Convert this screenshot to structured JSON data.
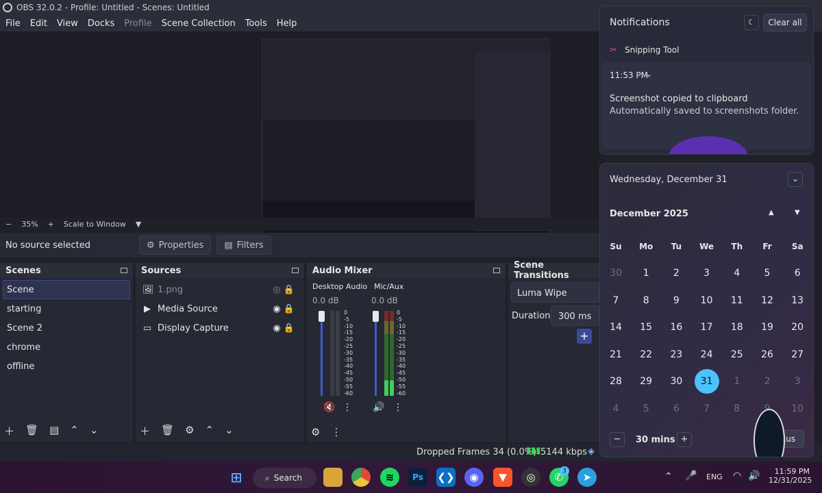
{
  "titlebar": {
    "title": "OBS 32.0.2 - Profile: Untitled - Scenes: Untitled"
  },
  "menu": [
    "File",
    "Edit",
    "View",
    "Docks",
    "Profile",
    "Scene Collection",
    "Tools",
    "Help"
  ],
  "zoom": {
    "minus": "−",
    "value": "35%",
    "plus": "+",
    "mode": "Scale to Window"
  },
  "source_bar": {
    "no_source": "No source selected",
    "properties": "Properties",
    "filters": "Filters"
  },
  "scenes": {
    "title": "Scenes",
    "items": [
      "Scene",
      "starting",
      "Scene 2",
      "chrome",
      "offline"
    ]
  },
  "sources": {
    "title": "Sources",
    "items": [
      {
        "label": "1.png",
        "icon": "image-icon"
      },
      {
        "label": "Media Source",
        "icon": "play-icon"
      },
      {
        "label": "Display Capture",
        "icon": "monitor-icon"
      }
    ]
  },
  "audio": {
    "title": "Audio Mixer",
    "channels": [
      {
        "name": "Desktop Audio",
        "level": "0.0 dB"
      },
      {
        "name": "Mic/Aux",
        "level": "0.0 dB"
      }
    ],
    "scale": [
      "0",
      "-5",
      "-10",
      "-15",
      "-20",
      "-25",
      "-30",
      "-35",
      "-40",
      "-45",
      "-50",
      "-55",
      "-60"
    ]
  },
  "transitions": {
    "title": "Scene Transitions",
    "type": "Luma Wipe",
    "duration_label": "Duration",
    "duration": "300 ms",
    "add": "+"
  },
  "status": {
    "dropped": "Dropped Frames 34 (0.0%)",
    "bitrate": "5144 kbps"
  },
  "notifications": {
    "title": "Notifications",
    "clear": "Clear all",
    "app": "Snipping Tool",
    "time": "11:53 PM",
    "headline": "Screenshot copied to clipboard",
    "body": "Automatically saved to screenshots folder."
  },
  "calendar": {
    "date_header": "Wednesday, December 31",
    "month": "December 2025",
    "dow": [
      "Su",
      "Mo",
      "Tu",
      "We",
      "Th",
      "Fr",
      "Sa"
    ],
    "weeks": [
      [
        "30",
        "1",
        "2",
        "3",
        "4",
        "5",
        "6"
      ],
      [
        "7",
        "8",
        "9",
        "10",
        "11",
        "12",
        "13"
      ],
      [
        "14",
        "15",
        "16",
        "17",
        "18",
        "19",
        "20"
      ],
      [
        "21",
        "22",
        "23",
        "24",
        "25",
        "26",
        "27"
      ],
      [
        "28",
        "29",
        "30",
        "31",
        "1",
        "2",
        "3"
      ],
      [
        "4",
        "5",
        "6",
        "7",
        "8",
        "9",
        "10"
      ]
    ],
    "today": "31",
    "focus_minus": "−",
    "focus_value": "30 mins",
    "focus_plus": "+",
    "focus_btn": "Focus"
  },
  "taskbar": {
    "search": "Search",
    "lang": "ENG",
    "time": "11:59 PM",
    "date": "12/31/2025",
    "badge": "3"
  },
  "colors": {
    "accent": "#4cc2ff",
    "selection": "#3f4a8a"
  }
}
